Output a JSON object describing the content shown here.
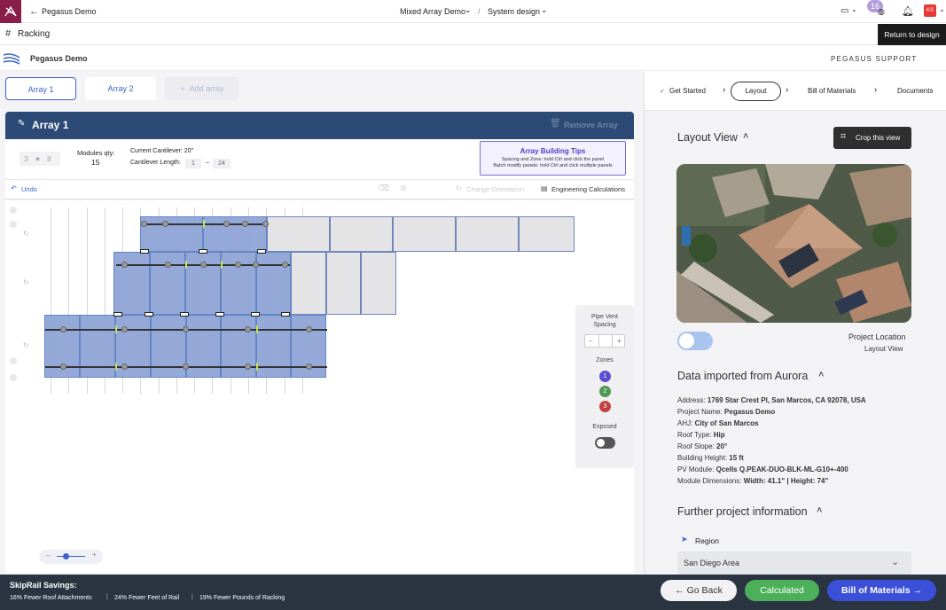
{
  "topbar": {
    "back_label": "Pegasus Demo",
    "project": "Mixed Array Demo",
    "separator": "/",
    "page": "System design",
    "notification_count": "16",
    "user_initials": "KS",
    "return_tooltip": "Return to design"
  },
  "racking": {
    "title": "Racking"
  },
  "brand": {
    "name": "Pegasus Demo",
    "support": "PEGASUS SUPPORT"
  },
  "arrays": {
    "tabs": [
      "Array 1",
      "Array 2"
    ],
    "add_label": "Add array",
    "current_title": "Array 1",
    "remove_label": "Remove Array",
    "grid_rows": "3",
    "grid_x": "×",
    "grid_cols": "8",
    "modules_label": "Modules qty:",
    "modules_qty": "15",
    "cantilever_label": "Current Cantilever: 20\"",
    "cantilever_length_label": "Cantilever Length:",
    "cantilever_min": "1",
    "cantilever_dash": "–",
    "cantilever_max": "24"
  },
  "tips": {
    "title": "Array Building Tips",
    "line1": "Spacing and Zone: hold Ctrl and click the panel",
    "line2": "Batch modify panels: hold Ctrl and click multiple panels"
  },
  "toolbar": {
    "undo": "Undo",
    "change_orientation": "Change Orientation",
    "engineering": "Engineering Calculations"
  },
  "side_controls": {
    "pipe_vent": "Pipe Vent Spacing",
    "minus": "–",
    "plus": "+",
    "zones_label": "Zones",
    "zones": [
      "1",
      "2",
      "3"
    ],
    "zone_colors": [
      "#5b4ed0",
      "#4e9a55",
      "#c24242"
    ],
    "exposed_label": "Exposed"
  },
  "zoom": {
    "minus": "–",
    "plus": "+",
    "level": 0.35
  },
  "steps": {
    "items": [
      "Get Started",
      "Layout",
      "Bill of Materials",
      "Documents"
    ],
    "separator": "›"
  },
  "layout_view": {
    "title": "Layout View",
    "crop_label": "Crop this view",
    "project_location": "Project Location",
    "layout_view_label": "Layout View"
  },
  "aurora": {
    "title": "Data imported from Aurora",
    "rows": [
      {
        "label": "Address:",
        "value": "1769 Star Crest Pl, San Marcos, CA 92078, USA"
      },
      {
        "label": "Project Name:",
        "value": "Pegasus Demo"
      },
      {
        "label": "AHJ:",
        "value": "City of San Marcos"
      },
      {
        "label": "Roof Type:",
        "value": "Hip"
      },
      {
        "label": "Roof Slope:",
        "value": "20°"
      },
      {
        "label": "Building Height:",
        "value": "15 ft"
      },
      {
        "label": "PV Module:",
        "value": "Qcells Q.PEAK-DUO-BLK-ML-G10+-400"
      }
    ],
    "dims_label": "Module Dimensions:",
    "dims_width": "Width: 41.1\"",
    "dims_sep": "|",
    "dims_height": "Height: 74\""
  },
  "further": {
    "title": "Further project information",
    "region_label": "Region",
    "region_value": "San Diego Area"
  },
  "bottom": {
    "savings_title": "SkipRail Savings:",
    "stat1": "16% Fewer Roof Attachments",
    "stat2": "24% Fewer Feet of Rail",
    "stat3": "19% Fewer Pounds of Racking",
    "divider": "|",
    "go_back": "Go Back",
    "calculated": "Calculated",
    "bom": "Bill of Materials"
  },
  "colors": {
    "header_navy": "#2d4a76",
    "calculated_green": "#4caf5a",
    "bom_blue": "#3b4fd8",
    "panel_blue": "#8fa5d6"
  }
}
